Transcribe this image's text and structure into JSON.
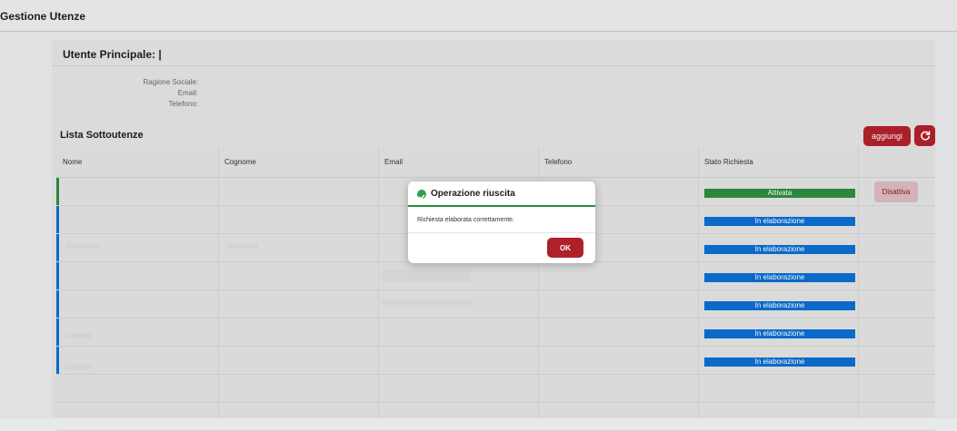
{
  "app": {
    "title": "Gestione Utenze"
  },
  "main_user": {
    "heading": "Utente Principale: |",
    "fields": [
      {
        "label": "Ragione Sociale:"
      },
      {
        "label": "Email:"
      },
      {
        "label": "Telefono:"
      }
    ]
  },
  "list": {
    "title": "Lista Sottoutenze",
    "add_label": "aggiungi",
    "refresh_icon": "refresh-icon",
    "columns": [
      "Nome",
      "Cognome",
      "Email",
      "Telefono",
      "Stato Richiesta"
    ],
    "rows": [
      {
        "status": "Attivata",
        "action": "Disattiva"
      },
      {
        "status": "In elaborazione"
      },
      {
        "status": "In elaborazione"
      },
      {
        "status": "In elaborazione"
      },
      {
        "status": "In elaborazione"
      },
      {
        "status": "In elaborazione"
      },
      {
        "status": "In elaborazione"
      }
    ]
  },
  "dialog": {
    "title": "Operazione riuscita",
    "message": "Richiesta elaborata correttamente.",
    "ok_label": "OK",
    "icon": "success-check-icon"
  },
  "colors": {
    "brand": "#b0202a",
    "status_active": "#2e8b3e",
    "status_processing": "#0a6ed1",
    "success_accent": "#2b8a3e"
  }
}
